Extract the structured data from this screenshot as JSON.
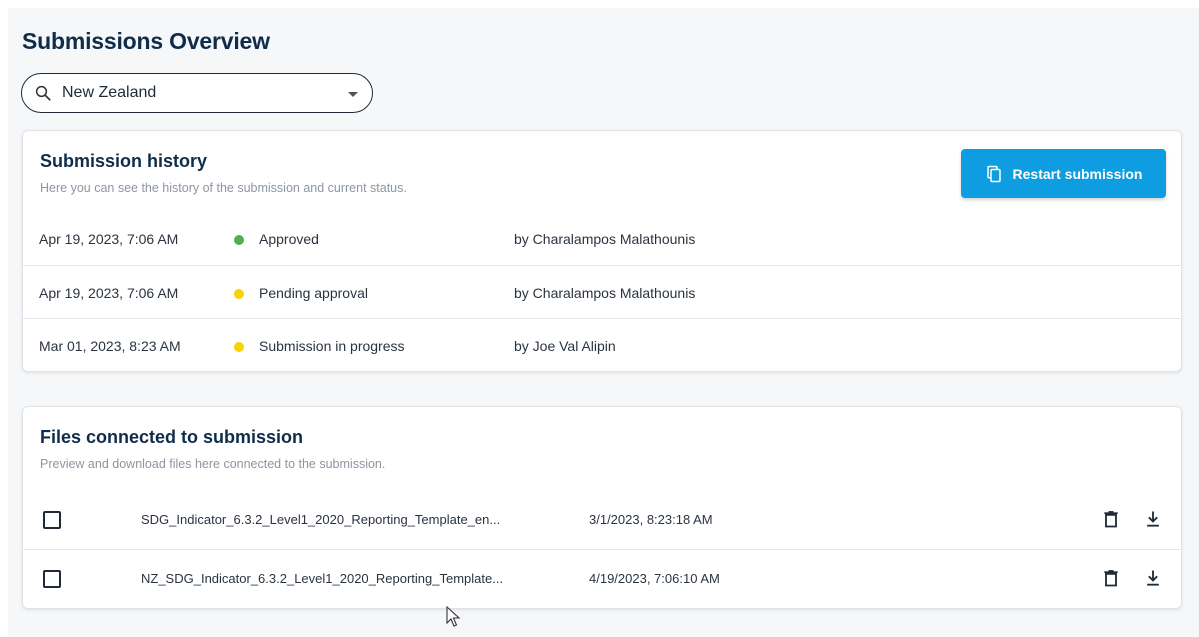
{
  "page": {
    "title": "Submissions Overview"
  },
  "country_select": {
    "value": "New Zealand"
  },
  "history": {
    "title": "Submission history",
    "subtitle": "Here you can see the history of the submission and current status.",
    "restart_label": "Restart submission",
    "rows": [
      {
        "date": "Apr 19, 2023, 7:06 AM",
        "status": "Approved",
        "status_color": "#4caf50",
        "by": "by Charalampos Malathounis"
      },
      {
        "date": "Apr 19, 2023, 7:06 AM",
        "status": "Pending approval",
        "status_color": "#f5d400",
        "by": "by Charalampos Malathounis"
      },
      {
        "date": "Mar 01, 2023, 8:23 AM",
        "status": "Submission in progress",
        "status_color": "#f5d400",
        "by": "by Joe Val Alipin"
      }
    ]
  },
  "files": {
    "title": "Files connected to submission",
    "subtitle": "Preview and download files here connected to the submission.",
    "rows": [
      {
        "name": "SDG_Indicator_6.3.2_Level1_2020_Reporting_Template_en...",
        "date": "3/1/2023, 8:23:18 AM"
      },
      {
        "name": "NZ_SDG_Indicator_6.3.2_Level1_2020_Reporting_Template...",
        "date": "4/19/2023, 7:06:10 AM"
      }
    ]
  },
  "colors": {
    "accent": "#0e9de0",
    "title": "#0f2d4a",
    "muted": "#8c96a2"
  },
  "icons": [
    "search-icon",
    "chevron-down-icon",
    "copy-icon",
    "trash-icon",
    "download-icon",
    "mouse-cursor-icon"
  ]
}
